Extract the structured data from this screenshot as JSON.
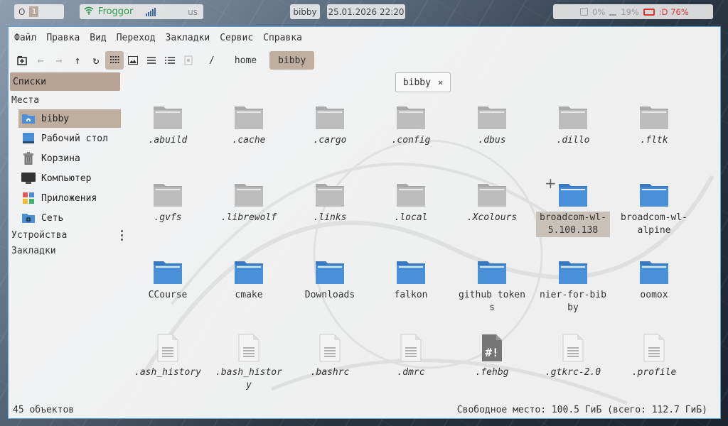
{
  "topbar": {
    "workspace_label": "O",
    "workspace_num": "1",
    "wifi_ssid": "Froggor",
    "keyboard_layout": "us",
    "window_title": "bibby",
    "datetime": "25.01.2026 22:20",
    "cpu": "0%",
    "mem": "19%",
    "battery": ":D 76%"
  },
  "menu": {
    "file": "Файл",
    "edit": "Правка",
    "view": "Вид",
    "go": "Переход",
    "bookmarks": "Закладки",
    "tools": "Сервис",
    "help": "Справка"
  },
  "path": {
    "root": "/",
    "home": "home",
    "current": "bibby"
  },
  "sidebar": {
    "lists_header": "Списки",
    "places_label": "Места",
    "places": [
      {
        "label": "bibby",
        "icon": "home-folder-icon"
      },
      {
        "label": "Рабочий стол",
        "icon": "desktop-icon"
      },
      {
        "label": "Корзина",
        "icon": "trash-icon"
      },
      {
        "label": "Компьютер",
        "icon": "computer-icon"
      },
      {
        "label": "Приложения",
        "icon": "applications-icon"
      },
      {
        "label": "Сеть",
        "icon": "network-icon"
      }
    ],
    "devices_label": "Устройства",
    "bookmarks_label": "Закладки"
  },
  "tab": {
    "label": "bibby"
  },
  "files": [
    {
      "name": ".abuild",
      "type": "folder",
      "hidden": true
    },
    {
      "name": ".cache",
      "type": "folder",
      "hidden": true
    },
    {
      "name": ".cargo",
      "type": "folder",
      "hidden": true
    },
    {
      "name": ".config",
      "type": "folder",
      "hidden": true
    },
    {
      "name": ".dbus",
      "type": "folder",
      "hidden": true
    },
    {
      "name": ".dillo",
      "type": "folder",
      "hidden": true
    },
    {
      "name": ".fltk",
      "type": "folder",
      "hidden": true
    },
    {
      "name": ".gvfs",
      "type": "folder",
      "hidden": true
    },
    {
      "name": ".librewolf",
      "type": "folder",
      "hidden": true
    },
    {
      "name": ".links",
      "type": "folder",
      "hidden": true
    },
    {
      "name": ".local",
      "type": "folder",
      "hidden": true
    },
    {
      "name": ".Xcolours",
      "type": "folder",
      "hidden": true
    },
    {
      "name": "broadcom-wl-5.100.138",
      "type": "folder-blue",
      "hidden": false,
      "selected": true
    },
    {
      "name": "broadcom-wl-alpine",
      "type": "folder-blue",
      "hidden": false
    },
    {
      "name": "CCourse",
      "type": "folder-blue",
      "hidden": false
    },
    {
      "name": "cmake",
      "type": "folder-blue",
      "hidden": false
    },
    {
      "name": "Downloads",
      "type": "folder-blue",
      "hidden": false
    },
    {
      "name": "falkon",
      "type": "folder-blue",
      "hidden": false
    },
    {
      "name": "github tokens",
      "type": "folder-blue",
      "hidden": false
    },
    {
      "name": "nier-for-bibby",
      "type": "folder-blue",
      "hidden": false
    },
    {
      "name": "oomox",
      "type": "folder-blue",
      "hidden": false
    },
    {
      "name": ".ash_history",
      "type": "text",
      "hidden": true
    },
    {
      "name": ".bash_history",
      "type": "text",
      "hidden": true
    },
    {
      "name": ".bashrc",
      "type": "text",
      "hidden": true
    },
    {
      "name": ".dmrc",
      "type": "text",
      "hidden": true
    },
    {
      "name": ".fehbg",
      "type": "script",
      "hidden": true
    },
    {
      "name": ".gtkrc-2.0",
      "type": "text",
      "hidden": true
    },
    {
      "name": ".profile",
      "type": "text",
      "hidden": true
    }
  ],
  "status": {
    "count": "45 объектов",
    "free_space": "Свободное место: 100.5 ГиБ (всего: 112.7 ГиБ)"
  },
  "colors": {
    "accent": "#bfae9e",
    "folder_grey": "#b8b8b8",
    "folder_blue": "#4a90d9",
    "window_border": "#5aa7d8"
  }
}
